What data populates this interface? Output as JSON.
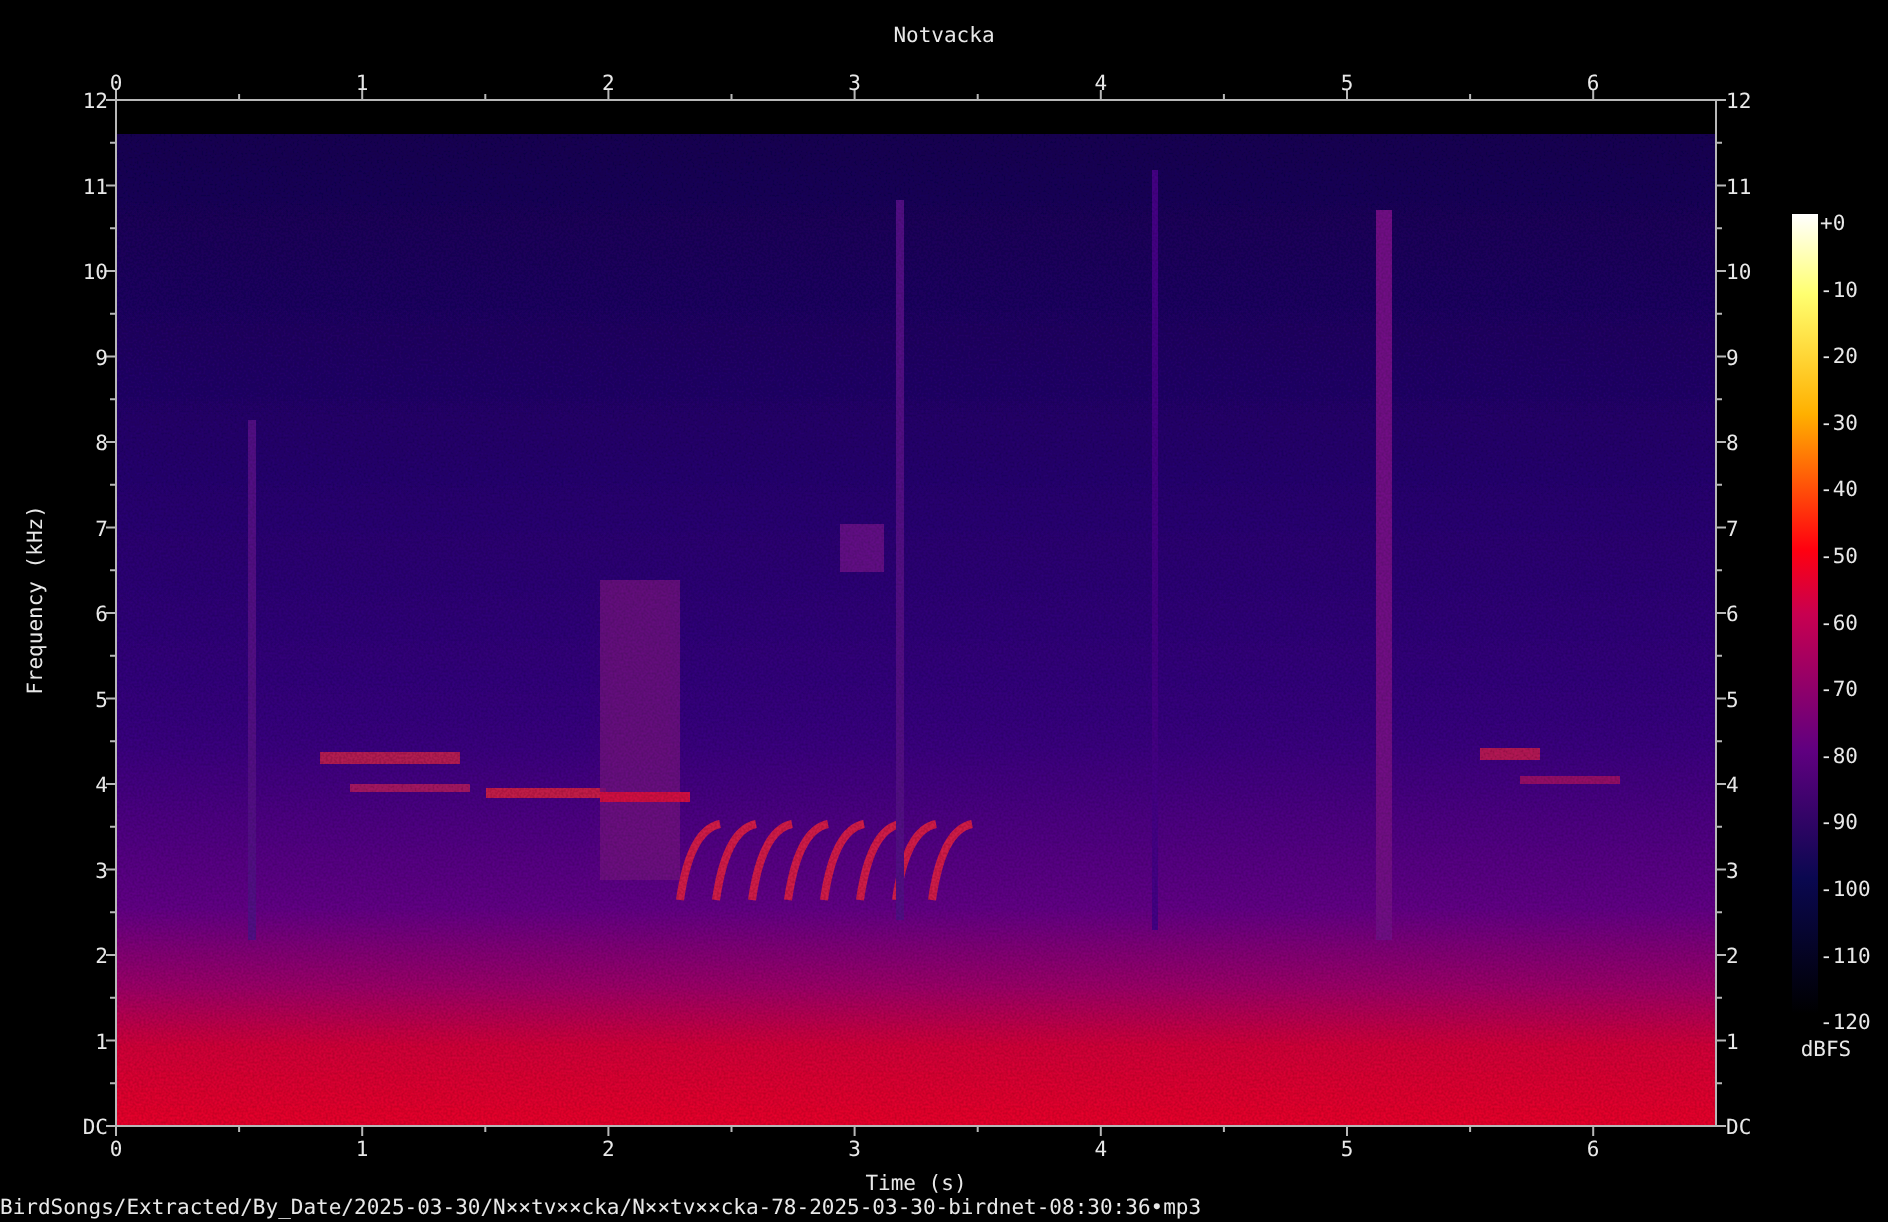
{
  "title": "Notvacka",
  "top_axis_ticks": [
    "0",
    "1",
    "2",
    "3",
    "4",
    "5",
    "6"
  ],
  "bottom_axis_ticks": [
    "0",
    "1",
    "2",
    "3",
    "4",
    "5",
    "6"
  ],
  "left_axis_ticks": [
    "12",
    "11",
    "10",
    "9",
    "8",
    "7",
    "6",
    "5",
    "4",
    "3",
    "2",
    "1",
    "DC"
  ],
  "right_axis_ticks": [
    "12",
    "11",
    "10",
    "9",
    "8",
    "7",
    "6",
    "5",
    "4",
    "3",
    "2",
    "1",
    "DC"
  ],
  "x_axis_label": "Time (s)",
  "y_axis_label": "Frequency (kHz)",
  "colorbar": {
    "ticks": [
      "+0",
      "-10",
      "-20",
      "-30",
      "-40",
      "-50",
      "-60",
      "-70",
      "-80",
      "-90",
      "-100",
      "-110",
      "-120"
    ],
    "unit": "dBFS"
  },
  "file_path": "BirdSongs/Extracted/By_Date/2025-03-30/N××tv××cka/N××tv××cka-78-2025-03-30-birdnet-08:30:36•mp3"
}
